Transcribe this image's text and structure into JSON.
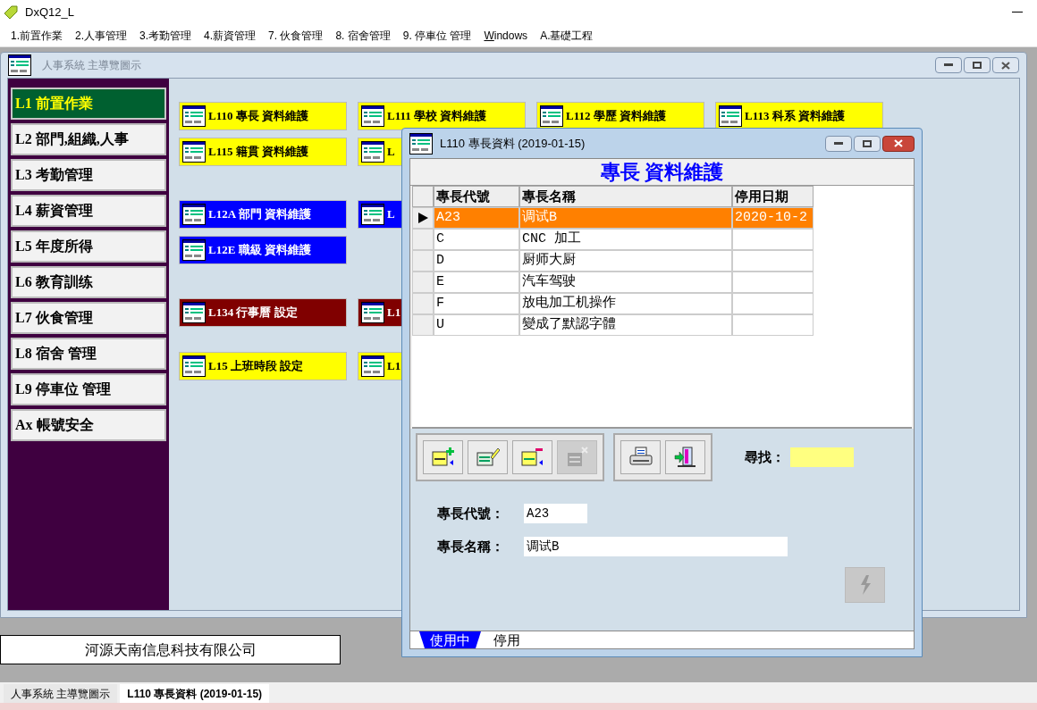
{
  "app": {
    "title": "DxQ12_L"
  },
  "menu": [
    {
      "label": "1.前置作業",
      "mnemonic_underlined": false
    },
    {
      "label": "2.人事管理",
      "mnemonic_underlined": false
    },
    {
      "label": "3.考勤管理",
      "mnemonic_underlined": false
    },
    {
      "label": "4.薪資管理",
      "mnemonic_underlined": false
    },
    {
      "label": "7. 伙食管理",
      "mnemonic_underlined": false
    },
    {
      "label": "8. 宿舍管理",
      "mnemonic_underlined": false
    },
    {
      "label": "9. 停車位 管理",
      "mnemonic_underlined": false
    },
    {
      "label": "Windows",
      "mnemonic_underlined": true
    },
    {
      "label": "A.基礎工程",
      "mnemonic_underlined": false
    }
  ],
  "main_window": {
    "title": "人事系統  主導覽圖示",
    "active": false,
    "sidebar": [
      {
        "label": "L1  前置作業",
        "selected": true
      },
      {
        "label": "L2 部門,組織,人事",
        "selected": false
      },
      {
        "label": "L3 考勤管理",
        "selected": false
      },
      {
        "label": "L4 薪資管理",
        "selected": false
      },
      {
        "label": "L5 年度所得",
        "selected": false
      },
      {
        "label": "L6 教育訓练",
        "selected": false
      },
      {
        "label": "L7 伙食管理",
        "selected": false
      },
      {
        "label": "L8 宿舍 管理",
        "selected": false
      },
      {
        "label": "L9 停車位 管理",
        "selected": false
      },
      {
        "label": "Ax 帳號安全",
        "selected": false
      }
    ],
    "tile_rows": [
      [
        {
          "label": "L110 專長 資料維護",
          "color": "#ffff00"
        },
        {
          "label": "L111 學校 資料維護",
          "color": "#ffff00"
        },
        {
          "label": "L112 學歷 資料維護",
          "color": "#ffff00"
        },
        {
          "label": "L113 科系 資料維護",
          "color": "#ffff00"
        }
      ],
      [
        {
          "label": "L115 籍貫 資料維護",
          "color": "#ffff00"
        },
        {
          "label": "L",
          "color": "#ffff00"
        }
      ],
      [
        {
          "label": "L12A 部門 資料維護",
          "color": "#0000ff"
        },
        {
          "label": "L",
          "color": "#0000ff"
        }
      ],
      [
        {
          "label": "L12E 職級 資料維護",
          "color": "#0000ff"
        }
      ],
      [
        {
          "label": "L134 行事曆 設定",
          "color": "#800000"
        },
        {
          "label": "L1",
          "color": "#800000"
        }
      ],
      [
        {
          "label": "L15 上班時段 設定",
          "color": "#ffff00"
        },
        {
          "label": "L1",
          "color": "#ffff00"
        }
      ]
    ]
  },
  "company_label": "河源天南信息科技有限公司",
  "dialog": {
    "title": "L110 專長資料 (2019-01-15)",
    "header": "專長 資料維護",
    "columns": [
      "專長代號",
      "專長名稱",
      "停用日期"
    ],
    "rows": [
      {
        "cells": [
          "A23",
          "调试B",
          "2020-10-2"
        ],
        "selected": true
      },
      {
        "cells": [
          "C",
          "CNC 加工",
          ""
        ],
        "selected": false
      },
      {
        "cells": [
          "D",
          "厨师大厨",
          ""
        ],
        "selected": false
      },
      {
        "cells": [
          "E",
          "汽车驾驶",
          ""
        ],
        "selected": false
      },
      {
        "cells": [
          "F",
          "放电加工机操作",
          ""
        ],
        "selected": false
      },
      {
        "cells": [
          "U",
          "變成了默認字體",
          ""
        ],
        "selected": false
      }
    ],
    "toolbar": [
      {
        "kind": "add",
        "disabled": false
      },
      {
        "kind": "edit",
        "disabled": false
      },
      {
        "kind": "delete",
        "disabled": false
      },
      {
        "kind": "cancel",
        "disabled": true
      }
    ],
    "toolbar_2": [
      {
        "kind": "print",
        "disabled": false
      },
      {
        "kind": "exit",
        "disabled": false
      }
    ],
    "search": {
      "label": "尋找："
    },
    "fields": [
      {
        "label": "專長代號：",
        "value": "A23",
        "wide": false
      },
      {
        "label": "專長名稱：",
        "value": "调试B",
        "wide": true
      }
    ],
    "action_disabled": true,
    "tabs": [
      {
        "label": "使用中",
        "selected": true
      },
      {
        "label": "停用",
        "selected": false
      }
    ]
  },
  "taskbar": [
    {
      "label": "人事系統 主導覽圖示",
      "selected": false
    },
    {
      "label": "L110 專長資料 (2019-01-15)",
      "selected": true
    }
  ]
}
